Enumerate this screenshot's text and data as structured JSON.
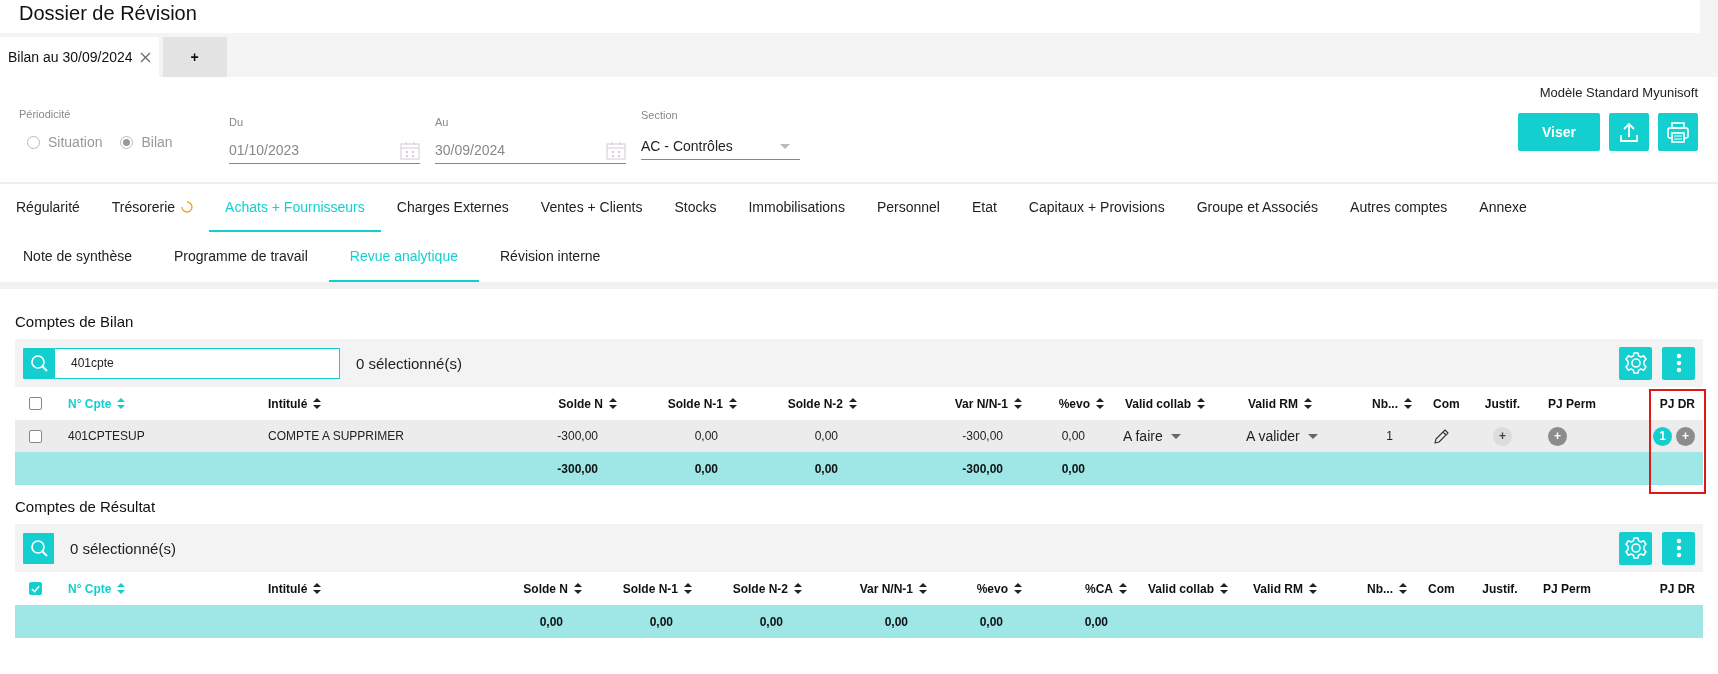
{
  "header": {
    "title": "Dossier de Révision"
  },
  "tabs": [
    {
      "label": "Bilan au 30/09/2024",
      "closable": true,
      "selected": true
    },
    {
      "label": "+",
      "closable": false,
      "selected": false
    }
  ],
  "filters": {
    "periodicity": {
      "label": "Périodicité",
      "disabled": true,
      "options": [
        {
          "label": "Situation",
          "selected": false
        },
        {
          "label": "Bilan",
          "selected": true
        }
      ]
    },
    "dates": [
      {
        "label": "Du",
        "value": "01/10/2023",
        "disabled": true
      },
      {
        "label": "Au",
        "value": "30/09/2024",
        "disabled": true
      }
    ],
    "section": {
      "label": "Section",
      "value": "AC - Contrôles"
    },
    "model": "Modèle Standard Myunisoft",
    "actions": [
      {
        "kind": "text",
        "label": "Viser"
      },
      {
        "kind": "upload"
      },
      {
        "kind": "print"
      }
    ]
  },
  "nav": [
    {
      "label": "Régularité",
      "selected": false,
      "loading": false
    },
    {
      "label": "Trésorerie",
      "selected": false,
      "loading": true
    },
    {
      "label": "Achats + Fournisseurs",
      "selected": true,
      "loading": false
    },
    {
      "label": "Charges Externes",
      "selected": false,
      "loading": false
    },
    {
      "label": "Ventes + Clients",
      "selected": false,
      "loading": false
    },
    {
      "label": "Stocks",
      "selected": false,
      "loading": false
    },
    {
      "label": "Immobilisations",
      "selected": false,
      "loading": false
    },
    {
      "label": "Personnel",
      "selected": false,
      "loading": false
    },
    {
      "label": "Etat",
      "selected": false,
      "loading": false
    },
    {
      "label": "Capitaux + Provisions",
      "selected": false,
      "loading": false
    },
    {
      "label": "Groupe et Associés",
      "selected": false,
      "loading": false
    },
    {
      "label": "Autres comptes",
      "selected": false,
      "loading": false
    },
    {
      "label": "Annexe",
      "selected": false,
      "loading": false
    }
  ],
  "subnav": [
    {
      "label": "Note de synthèse",
      "selected": false
    },
    {
      "label": "Programme de travail",
      "selected": false
    },
    {
      "label": "Revue analytique",
      "selected": true
    },
    {
      "label": "Révision interne",
      "selected": false
    }
  ],
  "tables": [
    {
      "title": "Comptes de Bilan",
      "search": {
        "value": "401cpte"
      },
      "selection": "0 sélectionné(s)",
      "select_all": {
        "checked": false
      },
      "annotation": {
        "kind": "frame"
      },
      "columns": [
        {
          "label": "N° Cpte",
          "sortable": true,
          "sorted": true
        },
        {
          "label": "Intitulé",
          "sortable": true,
          "sorted": false
        },
        {
          "label": "Solde N",
          "sortable": true,
          "sorted": false
        },
        {
          "label": "Solde N-1",
          "sortable": true,
          "sorted": false
        },
        {
          "label": "Solde N-2",
          "sortable": true,
          "sorted": false
        },
        {
          "label": "Var N/N-1",
          "sortable": true,
          "sorted": false
        },
        {
          "label": "%evo",
          "sortable": true,
          "sorted": false
        },
        {
          "label": "Valid collab",
          "sortable": true,
          "sorted": false
        },
        {
          "label": "Valid RM",
          "sortable": true,
          "sorted": false
        },
        {
          "label": "Nb...",
          "sortable": true,
          "sorted": false
        },
        {
          "label": "Com",
          "sortable": false,
          "sorted": false
        },
        {
          "label": "Justif.",
          "sortable": false,
          "sorted": false
        },
        {
          "label": "PJ Perm",
          "sortable": false,
          "sorted": false
        },
        {
          "label": "PJ DR",
          "sortable": false,
          "sorted": false
        }
      ],
      "rows": [
        {
          "checked": false,
          "cells": [
            {
              "kind": "text",
              "text": "401CPTESUP"
            },
            {
              "kind": "text",
              "text": "COMPTE A SUPPRIMER"
            },
            {
              "kind": "text",
              "text": "-300,00"
            },
            {
              "kind": "text",
              "text": "0,00"
            },
            {
              "kind": "text",
              "text": "0,00"
            },
            {
              "kind": "text",
              "text": "-300,00"
            },
            {
              "kind": "text",
              "text": "0,00"
            },
            {
              "kind": "dropdown",
              "text": "A faire"
            },
            {
              "kind": "dropdown",
              "text": "A valider"
            },
            {
              "kind": "text",
              "text": "1"
            },
            {
              "kind": "comment"
            },
            {
              "kind": "add",
              "text": "+"
            },
            {
              "kind": "attach",
              "text": "+"
            },
            {
              "kind": "attachments",
              "count": "1",
              "text": "+"
            }
          ]
        }
      ],
      "totals": [
        "-300,00",
        "0,00",
        "0,00",
        "-300,00",
        "0,00"
      ]
    },
    {
      "title": "Comptes de Résultat",
      "selection": "0 sélectionné(s)",
      "select_all": {
        "checked": true
      },
      "columns": [
        {
          "label": "N° Cpte",
          "sortable": true,
          "sorted": true
        },
        {
          "label": "Intitulé",
          "sortable": true,
          "sorted": false
        },
        {
          "label": "Solde N",
          "sortable": true,
          "sorted": false
        },
        {
          "label": "Solde N-1",
          "sortable": true,
          "sorted": false
        },
        {
          "label": "Solde N-2",
          "sortable": true,
          "sorted": false
        },
        {
          "label": "Var N/N-1",
          "sortable": true,
          "sorted": false
        },
        {
          "label": "%evo",
          "sortable": true,
          "sorted": false
        },
        {
          "label": "%CA",
          "sortable": true,
          "sorted": false
        },
        {
          "label": "Valid collab",
          "sortable": true,
          "sorted": false
        },
        {
          "label": "Valid RM",
          "sortable": true,
          "sorted": false
        },
        {
          "label": "Nb...",
          "sortable": true,
          "sorted": false
        },
        {
          "label": "Com",
          "sortable": false,
          "sorted": false
        },
        {
          "label": "Justif.",
          "sortable": false,
          "sorted": false
        },
        {
          "label": "PJ Perm",
          "sortable": false,
          "sorted": false
        },
        {
          "label": "PJ DR",
          "sortable": false,
          "sorted": false
        }
      ],
      "totals": [
        "0,00",
        "0,00",
        "0,00",
        "0,00",
        "0,00",
        "0,00"
      ]
    }
  ]
}
